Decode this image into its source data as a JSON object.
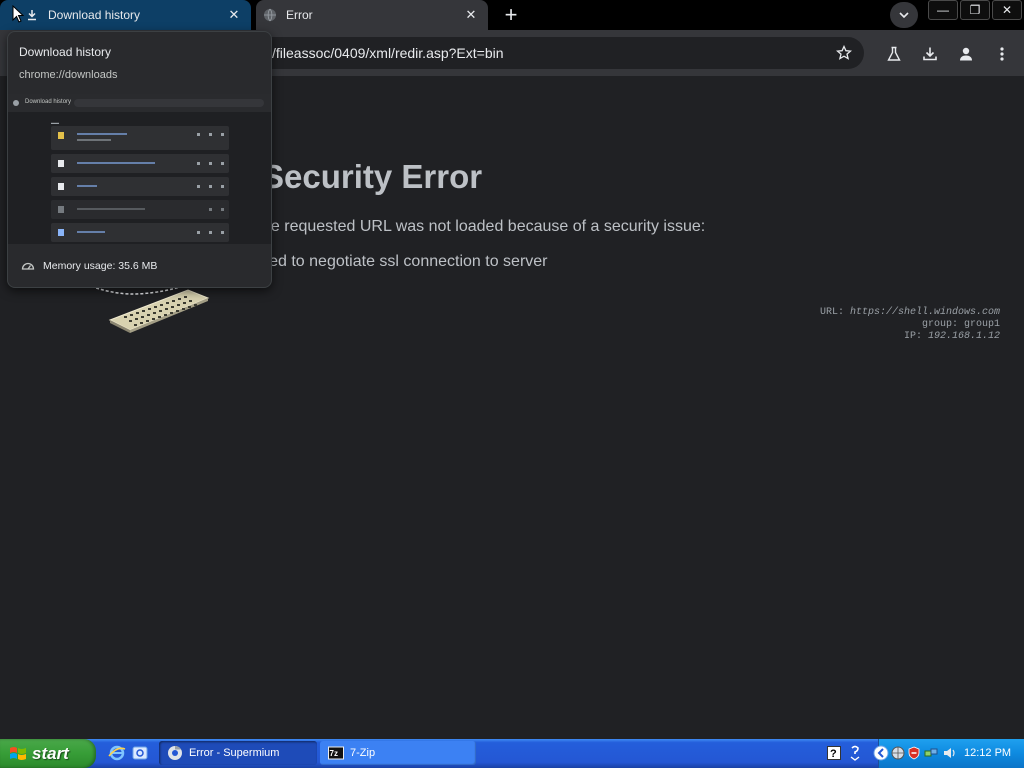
{
  "browser": {
    "tabs": [
      {
        "label": "Download history",
        "active": true,
        "icon": "download-icon"
      },
      {
        "label": "Error",
        "active": false,
        "icon": "globe-icon"
      }
    ],
    "address_bar": {
      "url": "/fileassoc/0409/xml/redir.asp?Ext=bin"
    },
    "window_controls": {
      "minimize": "—",
      "restore": "❐",
      "close": "✕"
    }
  },
  "hover_card": {
    "title": "Download history",
    "url": "chrome://downloads",
    "preview": {
      "title": "Download history"
    },
    "memory": "Memory usage: 35.6 MB"
  },
  "error_page": {
    "title": "Security Error",
    "description": "he requested URL was not loaded because of a security issue:",
    "detail": "iled to negotiate ssl connection to server",
    "meta": {
      "url_label": "URL:",
      "url_value": "https://shell.windows.com",
      "group_label": "group:",
      "group_value": "group1",
      "ip_label": "IP:",
      "ip_value": "192.168.1.12"
    }
  },
  "taskbar": {
    "start_label": "start",
    "tasks": [
      {
        "label": "Error - Supermium",
        "active": true
      },
      {
        "label": "7-Zip",
        "active": false
      }
    ],
    "clock": "12:12 PM"
  },
  "colors": {
    "active_tab": "#0d3f66",
    "page_bg": "#202124",
    "taskbar": "#245edb",
    "start": "#379d37"
  }
}
